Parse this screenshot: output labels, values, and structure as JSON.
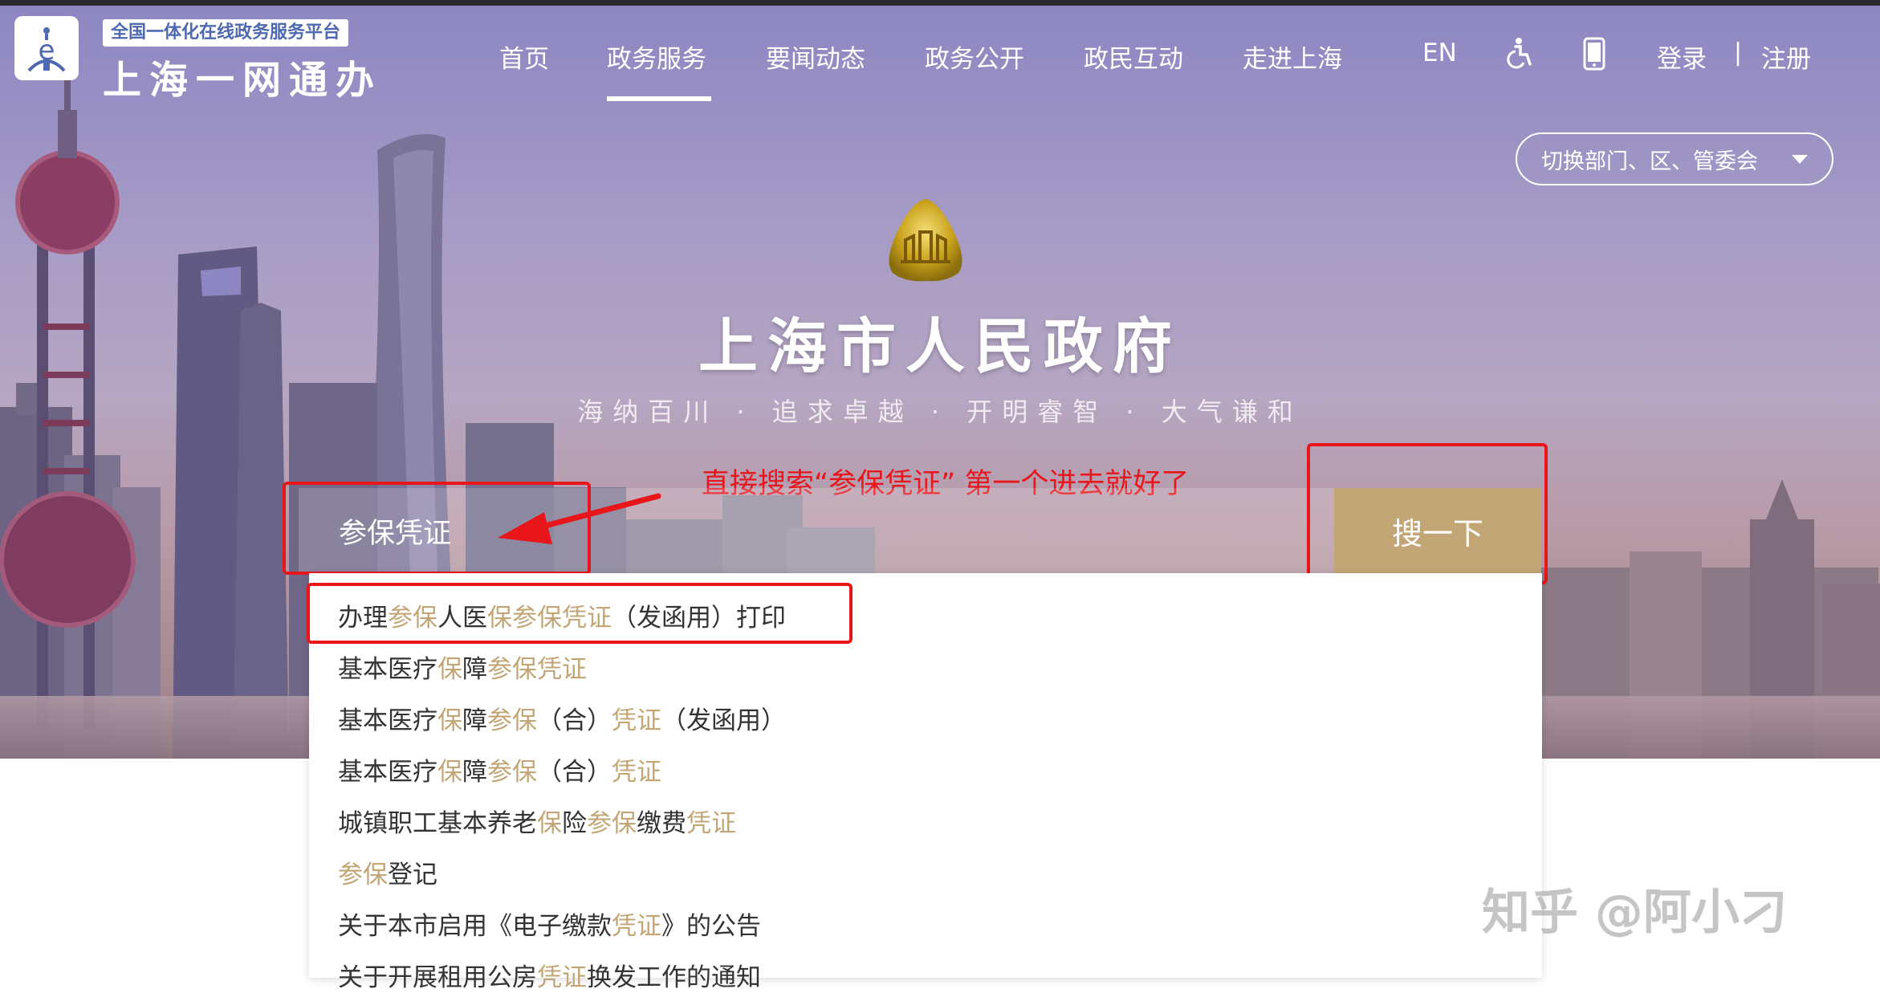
{
  "header": {
    "platform_subtitle": "全国一体化在线政务服务平台",
    "brand_name": "上海一网通办",
    "nav": [
      {
        "label": "首页",
        "active": false
      },
      {
        "label": "政务服务",
        "active": true
      },
      {
        "label": "要闻动态",
        "active": false
      },
      {
        "label": "政务公开",
        "active": false
      },
      {
        "label": "政民互动",
        "active": false
      },
      {
        "label": "走进上海",
        "active": false
      }
    ],
    "lang_label": "EN",
    "icons": [
      "accessibility-icon",
      "mobile-phone-icon"
    ],
    "login_label": "登录",
    "separator": "|",
    "register_label": "注册"
  },
  "dept_selector": {
    "label": "切换部门、区、管委会"
  },
  "hero": {
    "title": "上海市人民政府",
    "motto": "海纳百川 · 追求卓越 · 开明睿智 · 大气谦和"
  },
  "annotation": "直接搜索“参保凭证” 第一个进去就好了",
  "search": {
    "value": "参保凭证",
    "button_label": "搜一下"
  },
  "suggestions": [
    [
      {
        "t": "办理",
        "h": false
      },
      {
        "t": "参保",
        "h": true
      },
      {
        "t": "人医",
        "h": false
      },
      {
        "t": "保参保凭证",
        "h": true
      },
      {
        "t": "（发函用）打印",
        "h": false
      }
    ],
    [
      {
        "t": "基本医疗",
        "h": false
      },
      {
        "t": "保",
        "h": true
      },
      {
        "t": "障",
        "h": false
      },
      {
        "t": "参保凭证",
        "h": true
      }
    ],
    [
      {
        "t": "基本医疗",
        "h": false
      },
      {
        "t": "保",
        "h": true
      },
      {
        "t": "障",
        "h": false
      },
      {
        "t": "参保",
        "h": true
      },
      {
        "t": "（合）",
        "h": false
      },
      {
        "t": "凭证",
        "h": true
      },
      {
        "t": "（发函用）",
        "h": false
      }
    ],
    [
      {
        "t": "基本医疗",
        "h": false
      },
      {
        "t": "保",
        "h": true
      },
      {
        "t": "障",
        "h": false
      },
      {
        "t": "参保",
        "h": true
      },
      {
        "t": "（合）",
        "h": false
      },
      {
        "t": "凭证",
        "h": true
      }
    ],
    [
      {
        "t": "城镇职工基本养老",
        "h": false
      },
      {
        "t": "保",
        "h": true
      },
      {
        "t": "险",
        "h": false
      },
      {
        "t": "参保",
        "h": true
      },
      {
        "t": "缴费",
        "h": false
      },
      {
        "t": "凭证",
        "h": true
      }
    ],
    [
      {
        "t": "参保",
        "h": true
      },
      {
        "t": "登记",
        "h": false
      }
    ],
    [
      {
        "t": "关于本市启用《电子缴款",
        "h": false
      },
      {
        "t": "凭证",
        "h": true
      },
      {
        "t": "》的公告",
        "h": false
      }
    ],
    [
      {
        "t": "关于开展租用公房",
        "h": false
      },
      {
        "t": "凭证",
        "h": true
      },
      {
        "t": "换发工作的通知",
        "h": false
      }
    ]
  ],
  "watermark": "知乎 @阿小刁",
  "colors": {
    "accent_gold": "#c3a676",
    "annotation_red": "#e8151a",
    "logo_blue": "#4f68b2"
  }
}
